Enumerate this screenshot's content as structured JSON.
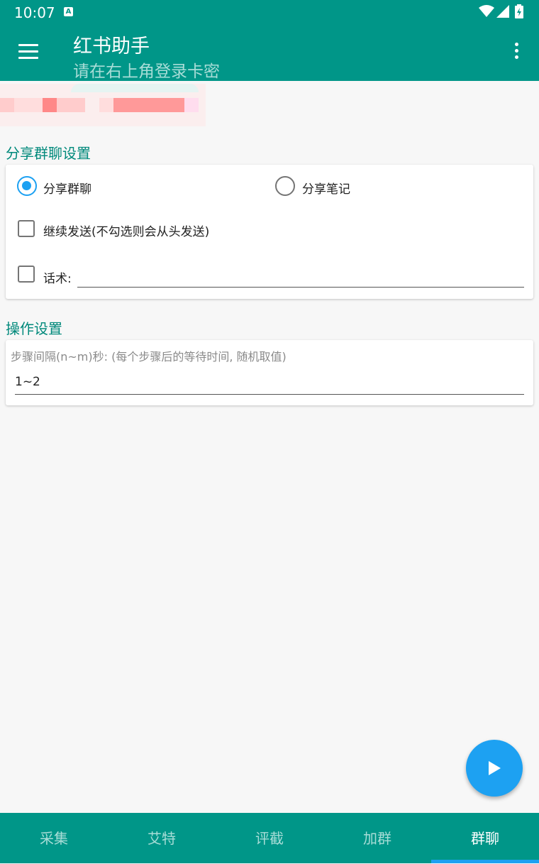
{
  "status_bar": {
    "time": "10:07",
    "notification_icon": "A"
  },
  "app_bar": {
    "title": "红书助手",
    "subtitle": "请在右上角登录卡密"
  },
  "share_section": {
    "title": "分享群聊设置",
    "radio_share_group": "分享群聊",
    "radio_share_note": "分享笔记",
    "selected_radio": "分享群聊",
    "continue_send_label": "继续发送(不勾选则会从头发送)",
    "continue_send_checked": false,
    "script_label": "话术:",
    "script_checked": false,
    "script_value": ""
  },
  "operation_section": {
    "title": "操作设置",
    "interval_hint": "步骤间隔(n~m)秒: (每个步骤后的等待时间, 随机取值)",
    "interval_value": "1~2"
  },
  "bottom_nav": {
    "items": [
      {
        "label": "采集"
      },
      {
        "label": "艾特"
      },
      {
        "label": "评截"
      },
      {
        "label": "加群"
      },
      {
        "label": "群聊"
      }
    ],
    "active": "群聊"
  },
  "colors": {
    "primary": "#009688",
    "accent": "#1da1f2",
    "section_title": "#00897b"
  },
  "icons": [
    "menu-icon",
    "more-vert-icon",
    "wifi-icon",
    "signal-icon",
    "battery-icon",
    "play-icon"
  ]
}
